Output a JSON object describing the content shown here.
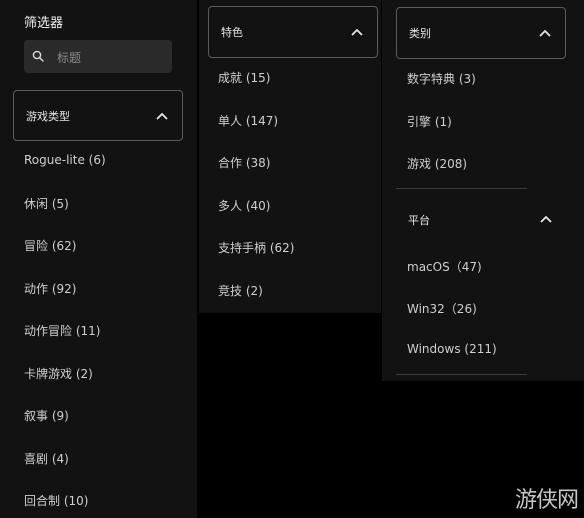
{
  "sidebar": {
    "title": "筛选器"
  },
  "search": {
    "placeholder": "标题"
  },
  "genre": {
    "title": "游戏类型",
    "items": [
      "Rogue-lite (6)",
      "休闲 (5)",
      "冒险 (62)",
      "动作 (92)",
      "动作冒险 (11)",
      "卡牌游戏 (2)",
      "叙事 (9)",
      "喜剧 (4)",
      "回合制 (10)"
    ]
  },
  "features": {
    "title": "特色",
    "items": [
      "成就 (15)",
      "单人 (147)",
      "合作 (38)",
      "多人 (40)",
      "支持手柄 (62)",
      "竞技 (2)"
    ]
  },
  "category": {
    "title": "类别",
    "items": [
      "数字特典 (3)",
      "引擎 (1)",
      "游戏 (208)"
    ]
  },
  "platform": {
    "title": "平台",
    "items": [
      "macOS（47)",
      "Win32（26)",
      "Windows (211)"
    ]
  },
  "watermark": "游侠网",
  "colors": {
    "background": "#000000",
    "panel": "#121212",
    "border": "#5b5b5b",
    "text": "#cfcfcf"
  }
}
